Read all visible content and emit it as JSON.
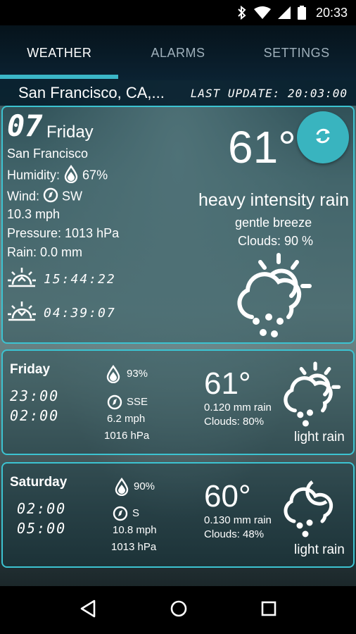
{
  "status_bar": {
    "time": "20:33"
  },
  "tabs": [
    {
      "label": "WEATHER",
      "active": true
    },
    {
      "label": "ALARMS",
      "active": false
    },
    {
      "label": "SETTINGS",
      "active": false
    }
  ],
  "location": {
    "city": "San Francisco, CA,...",
    "last_update": "LAST UPDATE: 20:03:00"
  },
  "current": {
    "date": "07",
    "day": "Friday",
    "place": "San Francisco",
    "humidity_label": "Humidity:",
    "humidity": "67%",
    "wind_label": "Wind:",
    "wind_dir": "SW",
    "wind_speed": "10.3 mph",
    "pressure": "Pressure: 1013 hPa",
    "rain": "Rain: 0.0 mm",
    "sunrise": "15:44:22",
    "sunset": "04:39:07",
    "temp": "61°",
    "condition": "heavy intensity rain",
    "breeze": "gentle breeze",
    "clouds": "Clouds: 90 %"
  },
  "forecast": [
    {
      "day": "Friday",
      "time_from": "23:00",
      "time_to": "02:00",
      "humidity": "93%",
      "wind_dir": "SSE",
      "wind_speed": "6.2 mph",
      "pressure": "1016 hPa",
      "temp": "61°",
      "rain": "0.120 mm rain",
      "clouds": "Clouds: 80%",
      "condition": "light rain"
    },
    {
      "day": "Saturday",
      "time_from": "02:00",
      "time_to": "05:00",
      "humidity": "90%",
      "wind_dir": "S",
      "wind_speed": "10.8 mph",
      "pressure": "1013 hPa",
      "temp": "60°",
      "rain": "0.130 mm rain",
      "clouds": "Clouds: 48%",
      "condition": "light rain"
    }
  ],
  "colors": {
    "accent": "#3cc3d1",
    "appbar": "#0b2232"
  },
  "icons": [
    "bluetooth-icon",
    "wifi-icon",
    "signal-icon",
    "battery-icon",
    "drop-icon",
    "compass-icon",
    "sunrise-icon",
    "sunset-icon",
    "refresh-icon",
    "sun-cloud-rain-icon",
    "moon-cloud-rain-icon",
    "back-icon",
    "home-icon",
    "recents-icon"
  ]
}
